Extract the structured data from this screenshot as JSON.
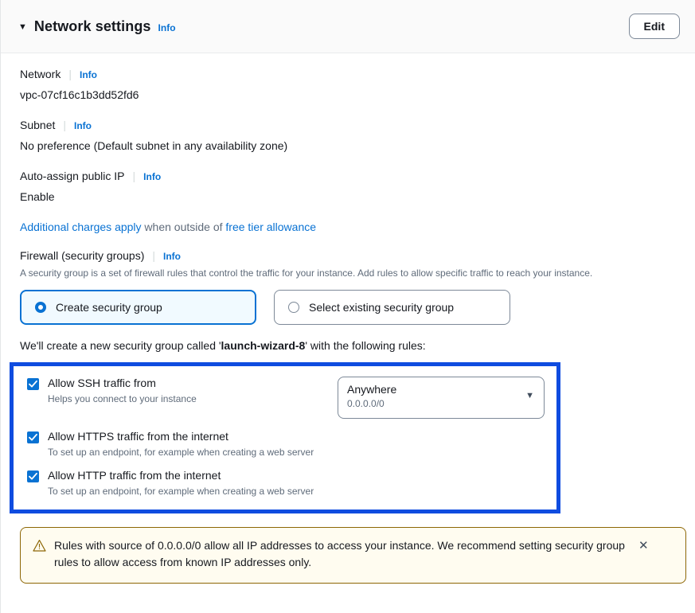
{
  "header": {
    "caret_icon": "caret-down-icon",
    "title": "Network settings",
    "info_label": "Info",
    "edit_label": "Edit"
  },
  "fields": {
    "network": {
      "label": "Network",
      "info_label": "Info",
      "value": "vpc-07cf16c1b3dd52fd6"
    },
    "subnet": {
      "label": "Subnet",
      "info_label": "Info",
      "value": "No preference (Default subnet in any availability zone)"
    },
    "auto_assign_ip": {
      "label": "Auto-assign public IP",
      "info_label": "Info",
      "value": "Enable"
    }
  },
  "charges_notice": {
    "link_before": "Additional charges apply",
    "middle": " when outside of ",
    "link_after": "free tier allowance"
  },
  "firewall": {
    "label": "Firewall (security groups)",
    "info_label": "Info",
    "description": "A security group is a set of firewall rules that control the traffic for your instance. Add rules to allow specific traffic to reach your instance.",
    "options": [
      {
        "label": "Create security group",
        "selected": true
      },
      {
        "label": "Select existing security group",
        "selected": false
      }
    ],
    "sg_line_prefix": "We'll create a new security group called '",
    "sg_name": "launch-wizard-8",
    "sg_line_suffix": "' with the following rules:"
  },
  "rules": [
    {
      "title": "Allow SSH traffic from",
      "subtitle": "Helps you connect to your instance",
      "checked": true,
      "has_select": true,
      "select_value": "Anywhere",
      "select_sub": "0.0.0.0/0",
      "select_arrow_icon": "caret-down-icon"
    },
    {
      "title": "Allow HTTPS traffic from the internet",
      "subtitle": "To set up an endpoint, for example when creating a web server",
      "checked": true,
      "has_select": false
    },
    {
      "title": "Allow HTTP traffic from the internet",
      "subtitle": "To set up an endpoint, for example when creating a web server",
      "checked": true,
      "has_select": false
    }
  ],
  "alert": {
    "icon": "warning-triangle-icon",
    "text": "Rules with source of 0.0.0.0/0 allow all IP addresses to access your instance. We recommend setting security group rules to allow access from known IP addresses only.",
    "close_icon": "close-icon"
  },
  "colors": {
    "accent_blue": "#0972d3",
    "highlight_blue": "#0f4ce0",
    "warning_border": "#8d6605",
    "warning_bg": "#fffcf0",
    "header_bg": "#fafafa"
  }
}
